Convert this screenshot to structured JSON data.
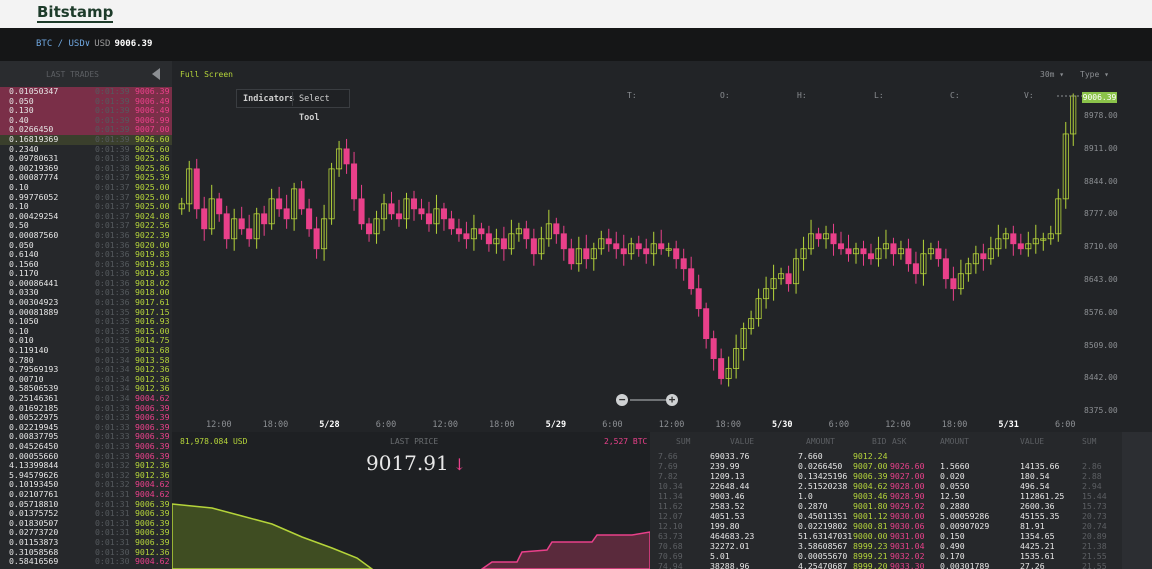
{
  "header": {
    "brand": "Bitstamp"
  },
  "pair": {
    "base": "BTC / USD",
    "dropdown": "∨",
    "quote_label": "USD",
    "price": "9006.39"
  },
  "trades": {
    "title": "LAST TRADES",
    "rows": [
      {
        "amt": "0.01050347",
        "time": "0:01:39",
        "price": "9006.39",
        "dir": "down",
        "hl": "sell"
      },
      {
        "amt": "0.050",
        "time": "0:01:39",
        "price": "9006.49",
        "dir": "down",
        "hl": "sell"
      },
      {
        "amt": "0.130",
        "time": "0:01:39",
        "price": "9006.49",
        "dir": "down",
        "hl": "sell"
      },
      {
        "amt": "0.40",
        "time": "0:01:39",
        "price": "9006.99",
        "dir": "down",
        "hl": "sell"
      },
      {
        "amt": "0.0266450",
        "time": "0:01:39",
        "price": "9007.00",
        "dir": "down",
        "hl": "sell"
      },
      {
        "amt": "0.16819369",
        "time": "0:01:39",
        "price": "9026.60",
        "dir": "up",
        "hl": "buy"
      },
      {
        "amt": "0.2340",
        "time": "0:01:39",
        "price": "9026.60",
        "dir": "up",
        "hl": ""
      },
      {
        "amt": "0.09780631",
        "time": "0:01:38",
        "price": "9025.86",
        "dir": "up",
        "hl": ""
      },
      {
        "amt": "0.00219369",
        "time": "0:01:38",
        "price": "9025.86",
        "dir": "up",
        "hl": ""
      },
      {
        "amt": "0.00087774",
        "time": "0:01:37",
        "price": "9025.39",
        "dir": "up",
        "hl": ""
      },
      {
        "amt": "0.10",
        "time": "0:01:37",
        "price": "9025.00",
        "dir": "up",
        "hl": ""
      },
      {
        "amt": "0.99776052",
        "time": "0:01:37",
        "price": "9025.00",
        "dir": "up",
        "hl": ""
      },
      {
        "amt": "0.10",
        "time": "0:01:37",
        "price": "9025.00",
        "dir": "up",
        "hl": ""
      },
      {
        "amt": "0.00429254",
        "time": "0:01:37",
        "price": "9024.08",
        "dir": "up",
        "hl": ""
      },
      {
        "amt": "0.50",
        "time": "0:01:37",
        "price": "9022.56",
        "dir": "up",
        "hl": ""
      },
      {
        "amt": "0.00087560",
        "time": "0:01:36",
        "price": "9022.39",
        "dir": "up",
        "hl": ""
      },
      {
        "amt": "0.050",
        "time": "0:01:36",
        "price": "9020.00",
        "dir": "up",
        "hl": ""
      },
      {
        "amt": "0.6140",
        "time": "0:01:36",
        "price": "9019.83",
        "dir": "up",
        "hl": ""
      },
      {
        "amt": "0.1560",
        "time": "0:01:36",
        "price": "9019.83",
        "dir": "up",
        "hl": ""
      },
      {
        "amt": "0.1170",
        "time": "0:01:36",
        "price": "9019.83",
        "dir": "up",
        "hl": ""
      },
      {
        "amt": "0.00086441",
        "time": "0:01:36",
        "price": "9018.02",
        "dir": "up",
        "hl": ""
      },
      {
        "amt": "0.0330",
        "time": "0:01:36",
        "price": "9018.00",
        "dir": "up",
        "hl": ""
      },
      {
        "amt": "0.00304923",
        "time": "0:01:36",
        "price": "9017.61",
        "dir": "up",
        "hl": ""
      },
      {
        "amt": "0.00081889",
        "time": "0:01:35",
        "price": "9017.15",
        "dir": "up",
        "hl": ""
      },
      {
        "amt": "0.1050",
        "time": "0:01:35",
        "price": "9016.93",
        "dir": "up",
        "hl": ""
      },
      {
        "amt": "0.10",
        "time": "0:01:35",
        "price": "9015.00",
        "dir": "up",
        "hl": ""
      },
      {
        "amt": "0.010",
        "time": "0:01:35",
        "price": "9014.75",
        "dir": "up",
        "hl": ""
      },
      {
        "amt": "0.119140",
        "time": "0:01:35",
        "price": "9013.68",
        "dir": "up",
        "hl": ""
      },
      {
        "amt": "0.780",
        "time": "0:01:34",
        "price": "9013.58",
        "dir": "up",
        "hl": ""
      },
      {
        "amt": "0.79569193",
        "time": "0:01:34",
        "price": "9012.36",
        "dir": "up",
        "hl": ""
      },
      {
        "amt": "0.00710",
        "time": "0:01:34",
        "price": "9012.36",
        "dir": "up",
        "hl": ""
      },
      {
        "amt": "0.58506539",
        "time": "0:01:34",
        "price": "9012.36",
        "dir": "up",
        "hl": ""
      },
      {
        "amt": "0.25146361",
        "time": "0:01:34",
        "price": "9004.62",
        "dir": "down",
        "hl": ""
      },
      {
        "amt": "0.01692185",
        "time": "0:01:33",
        "price": "9006.39",
        "dir": "down",
        "hl": ""
      },
      {
        "amt": "0.00522975",
        "time": "0:01:33",
        "price": "9006.39",
        "dir": "down",
        "hl": ""
      },
      {
        "amt": "0.02219945",
        "time": "0:01:33",
        "price": "9006.39",
        "dir": "down",
        "hl": ""
      },
      {
        "amt": "0.00837795",
        "time": "0:01:33",
        "price": "9006.39",
        "dir": "down",
        "hl": ""
      },
      {
        "amt": "0.04526450",
        "time": "0:01:33",
        "price": "9006.39",
        "dir": "down",
        "hl": ""
      },
      {
        "amt": "0.00055660",
        "time": "0:01:33",
        "price": "9006.39",
        "dir": "down",
        "hl": ""
      },
      {
        "amt": "4.13399844",
        "time": "0:01:32",
        "price": "9012.36",
        "dir": "up",
        "hl": ""
      },
      {
        "amt": "5.94579626",
        "time": "0:01:32",
        "price": "9012.36",
        "dir": "up",
        "hl": ""
      },
      {
        "amt": "0.10193450",
        "time": "0:01:32",
        "price": "9004.62",
        "dir": "down",
        "hl": ""
      },
      {
        "amt": "0.02107761",
        "time": "0:01:31",
        "price": "9004.62",
        "dir": "down",
        "hl": ""
      },
      {
        "amt": "0.05718810",
        "time": "0:01:31",
        "price": "9006.39",
        "dir": "up",
        "hl": ""
      },
      {
        "amt": "0.01375752",
        "time": "0:01:31",
        "price": "9006.39",
        "dir": "up",
        "hl": ""
      },
      {
        "amt": "0.01830507",
        "time": "0:01:31",
        "price": "9006.39",
        "dir": "up",
        "hl": ""
      },
      {
        "amt": "0.02773720",
        "time": "0:01:31",
        "price": "9006.39",
        "dir": "up",
        "hl": ""
      },
      {
        "amt": "0.01153873",
        "time": "0:01:31",
        "price": "9006.39",
        "dir": "up",
        "hl": ""
      },
      {
        "amt": "0.31058568",
        "time": "0:01:30",
        "price": "9012.36",
        "dir": "up",
        "hl": ""
      },
      {
        "amt": "0.58416569",
        "time": "0:01:30",
        "price": "9004.62",
        "dir": "down",
        "hl": ""
      }
    ]
  },
  "chart": {
    "fullscreen_label": "Full Screen",
    "interval_label": "30m",
    "type_label": "Type",
    "indicators_label": "Indicators",
    "select_label": "Select",
    "tool_label": "Tool",
    "ohlc_labels": [
      "T:",
      "O:",
      "H:",
      "L:",
      "C:",
      "V:"
    ],
    "current_price": "9006.39",
    "zoom_out": "−",
    "zoom_in": "+"
  },
  "chart_data": {
    "type": "candlestick",
    "price_ticks": [
      "8978.00",
      "8911.00",
      "8844.00",
      "8777.00",
      "8710.00",
      "8643.00",
      "8576.00",
      "8509.00",
      "8442.00",
      "8375.00"
    ],
    "time_ticks": [
      {
        "label": "12:00",
        "bold": false
      },
      {
        "label": "18:00",
        "bold": false
      },
      {
        "label": "5/28",
        "bold": true
      },
      {
        "label": "6:00",
        "bold": false
      },
      {
        "label": "12:00",
        "bold": false
      },
      {
        "label": "18:00",
        "bold": false
      },
      {
        "label": "5/29",
        "bold": true
      },
      {
        "label": "6:00",
        "bold": false
      },
      {
        "label": "12:00",
        "bold": false
      },
      {
        "label": "18:00",
        "bold": false
      },
      {
        "label": "5/30",
        "bold": true
      },
      {
        "label": "6:00",
        "bold": false
      },
      {
        "label": "12:00",
        "bold": false
      },
      {
        "label": "18:00",
        "bold": false
      },
      {
        "label": "5/31",
        "bold": true
      },
      {
        "label": "6:00",
        "bold": false
      }
    ],
    "ylim": [
      8375,
      9006
    ],
    "closes": [
      8790,
      8860,
      8780,
      8740,
      8800,
      8770,
      8720,
      8760,
      8740,
      8720,
      8770,
      8750,
      8800,
      8780,
      8760,
      8820,
      8780,
      8740,
      8700,
      8760,
      8860,
      8900,
      8870,
      8800,
      8750,
      8730,
      8760,
      8790,
      8770,
      8760,
      8800,
      8780,
      8770,
      8750,
      8780,
      8760,
      8740,
      8730,
      8720,
      8740,
      8730,
      8710,
      8720,
      8700,
      8730,
      8740,
      8720,
      8690,
      8720,
      8750,
      8730,
      8700,
      8670,
      8700,
      8680,
      8700,
      8720,
      8710,
      8700,
      8690,
      8710,
      8700,
      8690,
      8710,
      8700,
      8700,
      8680,
      8660,
      8620,
      8580,
      8520,
      8480,
      8440,
      8460,
      8500,
      8540,
      8560,
      8600,
      8620,
      8640,
      8650,
      8630,
      8680,
      8700,
      8730,
      8720,
      8730,
      8710,
      8700,
      8690,
      8700,
      8690,
      8680,
      8700,
      8710,
      8690,
      8700,
      8670,
      8650,
      8690,
      8700,
      8680,
      8640,
      8620,
      8650,
      8670,
      8690,
      8680,
      8700,
      8720,
      8730,
      8710,
      8700,
      8710,
      8720,
      8720,
      8730,
      8800,
      8930,
      9006
    ]
  },
  "depth": {
    "left_volume": "81,978.084 USD",
    "last_price_label": "LAST PRICE",
    "last_price": "9017.91",
    "arrow": "↓",
    "right_volume": "2,527 BTC"
  },
  "book": {
    "headers": [
      "SUM",
      "VALUE",
      "AMOUNT",
      "BID",
      "ASK",
      "AMOUNT",
      "VALUE",
      "SUM"
    ],
    "rows": [
      {
        "sum": "7.66",
        "value": "69033.76",
        "amount": "7.660",
        "bid": "9012.24",
        "ask": "",
        "aamt": "",
        "aval": "",
        "asum": ""
      },
      {
        "sum": "7.69",
        "value": "239.99",
        "amount": "0.0266450",
        "bid": "9007.00",
        "ask": "9026.60",
        "aamt": "1.5660",
        "aval": "14135.66",
        "asum": "2.86"
      },
      {
        "sum": "7.82",
        "value": "1209.13",
        "amount": "0.13425196",
        "bid": "9006.39",
        "ask": "9027.00",
        "aamt": "0.020",
        "aval": "180.54",
        "asum": "2.88"
      },
      {
        "sum": "10.34",
        "value": "22648.44",
        "amount": "2.51520238",
        "bid": "9004.62",
        "ask": "9028.00",
        "aamt": "0.0550",
        "aval": "496.54",
        "asum": "2.94"
      },
      {
        "sum": "11.34",
        "value": "9003.46",
        "amount": "1.0",
        "bid": "9003.46",
        "ask": "9028.90",
        "aamt": "12.50",
        "aval": "112861.25",
        "asum": "15.44"
      },
      {
        "sum": "11.62",
        "value": "2583.52",
        "amount": "0.2870",
        "bid": "9001.80",
        "ask": "9029.02",
        "aamt": "0.2880",
        "aval": "2600.36",
        "asum": "15.73"
      },
      {
        "sum": "12.07",
        "value": "4051.53",
        "amount": "0.45011351",
        "bid": "9001.12",
        "ask": "9030.00",
        "aamt": "5.00059286",
        "aval": "45155.35",
        "asum": "20.73"
      },
      {
        "sum": "12.10",
        "value": "199.80",
        "amount": "0.02219802",
        "bid": "9000.81",
        "ask": "9030.06",
        "aamt": "0.00907029",
        "aval": "81.91",
        "asum": "20.74"
      },
      {
        "sum": "63.73",
        "value": "464683.23",
        "amount": "51.63147031",
        "bid": "9000.00",
        "ask": "9031.00",
        "aamt": "0.150",
        "aval": "1354.65",
        "asum": "20.89"
      },
      {
        "sum": "70.68",
        "value": "32272.01",
        "amount": "3.58608567",
        "bid": "8999.23",
        "ask": "9031.04",
        "aamt": "0.490",
        "aval": "4425.21",
        "asum": "21.38"
      },
      {
        "sum": "70.69",
        "value": "5.01",
        "amount": "0.00055670",
        "bid": "8999.21",
        "ask": "9032.02",
        "aamt": "0.170",
        "aval": "1535.61",
        "asum": "21.55"
      },
      {
        "sum": "74.94",
        "value": "38288.96",
        "amount": "4.25470687",
        "bid": "8999.20",
        "ask": "9033.30",
        "aamt": "0.00301789",
        "aval": "27.26",
        "asum": "21.55"
      }
    ]
  }
}
